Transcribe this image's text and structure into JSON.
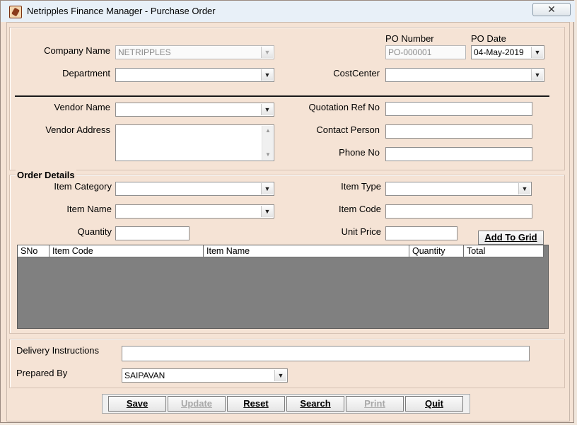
{
  "window": {
    "title": "Netripples Finance Manager - Purchase Order",
    "close_icon": "close-x-icon"
  },
  "header": {
    "company_name_label": "Company Name",
    "company_name_value": "NETRIPPLES",
    "department_label": "Department",
    "department_value": "",
    "po_number_label": "PO Number",
    "po_number_value": "PO-000001",
    "po_date_label": "PO Date",
    "po_date_value": "04-May-2019",
    "cost_center_label": "CostCenter",
    "cost_center_value": ""
  },
  "vendor": {
    "vendor_name_label": "Vendor Name",
    "vendor_name_value": "",
    "vendor_address_label": "Vendor Address",
    "vendor_address_value": "",
    "quotation_ref_label": "Quotation Ref No",
    "quotation_ref_value": "",
    "contact_person_label": "Contact Person",
    "contact_person_value": "",
    "phone_label": "Phone No",
    "phone_value": ""
  },
  "order": {
    "section_title": "Order Details",
    "item_category_label": "Item Category",
    "item_category_value": "",
    "item_type_label": "Item Type",
    "item_type_value": "",
    "item_name_label": "Item Name",
    "item_name_value": "",
    "item_code_label": "Item Code",
    "item_code_value": "",
    "quantity_label": "Quantity",
    "quantity_value": "",
    "unit_price_label": "Unit Price",
    "unit_price_value": "",
    "add_to_grid_label": "Add To Grid",
    "grid_columns": [
      "SNo",
      "Item Code",
      "Item Name",
      "Quantity",
      "Total"
    ]
  },
  "footer": {
    "delivery_label": "Delivery Instructions",
    "delivery_value": "",
    "prepared_by_label": "Prepared By",
    "prepared_by_value": "SAIPAVAN"
  },
  "buttons": {
    "save": "Save",
    "update": "Update",
    "reset": "Reset",
    "search": "Search",
    "print": "Print",
    "quit": "Quit"
  },
  "colors": {
    "form_background": "#f5e3d5",
    "grid_background": "#808080",
    "titlebar": "#e8f0f8"
  }
}
